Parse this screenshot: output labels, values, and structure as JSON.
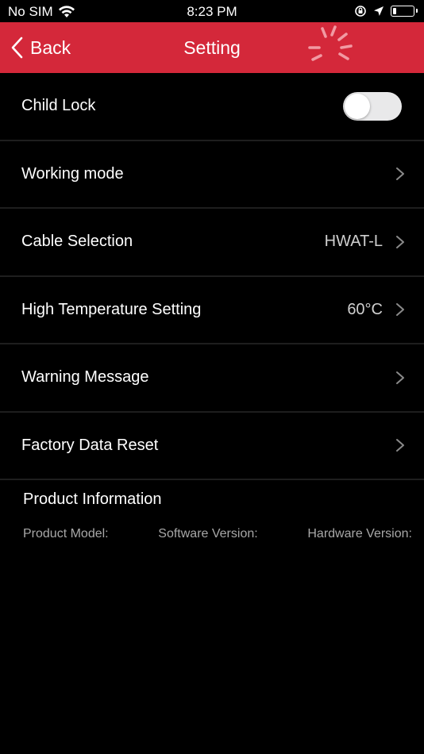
{
  "status_bar": {
    "carrier": "No SIM",
    "time": "8:23 PM"
  },
  "navbar": {
    "back_label": "Back",
    "title": "Setting",
    "background": "#d4283a"
  },
  "settings": {
    "child_lock": {
      "label": "Child Lock",
      "enabled": false
    },
    "working_mode": {
      "label": "Working mode"
    },
    "cable_selection": {
      "label": "Cable Selection",
      "value": "HWAT-L"
    },
    "high_temperature": {
      "label": "High Temperature Setting",
      "value": "60°C"
    },
    "warning_message": {
      "label": "Warning Message"
    },
    "factory_reset": {
      "label": "Factory Data Reset"
    }
  },
  "product_info": {
    "title": "Product Information",
    "model_label": "Product Model:",
    "software_label": "Software Version:",
    "hardware_label": "Hardware Version:"
  }
}
